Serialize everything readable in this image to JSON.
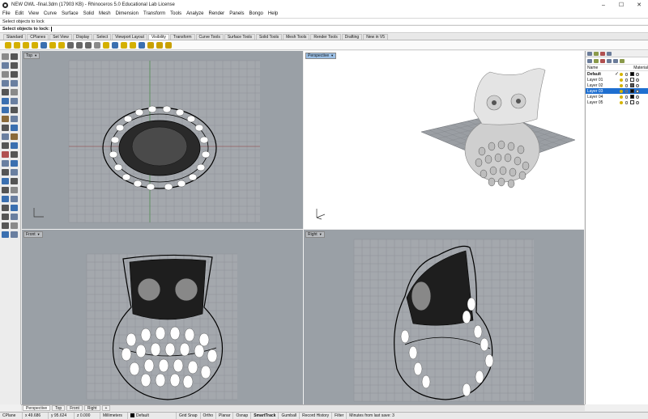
{
  "window": {
    "title": "NEW OWL -final.3dm (17903 KB) - Rhinoceros 5.0 Educational Lab License",
    "controls": [
      "–",
      "☐",
      "✕"
    ]
  },
  "menu": [
    "File",
    "Edit",
    "View",
    "Curve",
    "Surface",
    "Solid",
    "Mesh",
    "Dimension",
    "Transform",
    "Tools",
    "Analyze",
    "Render",
    "Panels",
    "Bongo",
    "Help"
  ],
  "command": {
    "history": "Select objects to lock",
    "prompt": "Select objects to lock"
  },
  "toolbar_tabs": [
    "Standard",
    "CPlanes",
    "Set View",
    "Display",
    "Select",
    "Viewport Layout",
    "Visibility",
    "Transform",
    "Curve Tools",
    "Surface Tools",
    "Solid Tools",
    "Mesh Tools",
    "Render Tools",
    "Drafting",
    "New in V5"
  ],
  "active_toolbar_tab": "Visibility",
  "toolbar_icon_colors": [
    "#d4b000",
    "#d4b000",
    "#d4b000",
    "#d4b000",
    "#3a6fb0",
    "#d4b000",
    "#d4b000",
    "#666",
    "#666",
    "#666",
    "#8a8a8a",
    "#d4b000",
    "#3a6fb0",
    "#d4b000",
    "#d4b000",
    "#3a6fb0",
    "#c8a000",
    "#c8a000",
    "#c8a000"
  ],
  "viewports": {
    "top": {
      "label": "Top"
    },
    "perspective": {
      "label": "Perspective"
    },
    "front": {
      "label": "Front"
    },
    "right": {
      "label": "Right"
    }
  },
  "layers": {
    "columns": {
      "name": "Name",
      "material": "Material"
    },
    "rows": [
      {
        "name": "Default",
        "current": true,
        "color": "#000000",
        "selected": false
      },
      {
        "name": "Layer 01",
        "current": false,
        "color": "#ffffff",
        "selected": false
      },
      {
        "name": "Layer 02",
        "current": false,
        "color": "#555555",
        "selected": false
      },
      {
        "name": "Layer 03",
        "current": false,
        "color": "#000000",
        "selected": true
      },
      {
        "name": "Layer 04",
        "current": false,
        "color": "#000000",
        "selected": false
      },
      {
        "name": "Layer 05",
        "current": false,
        "color": "#ffffff",
        "selected": false
      }
    ]
  },
  "viewport_tabs": [
    "Perspective",
    "Top",
    "Front",
    "Right",
    "+"
  ],
  "status": {
    "cplane": "CPlane",
    "x": "x 49.686",
    "y": "y 95.624",
    "z": "z 0.000",
    "units": "Millimeters",
    "layer": "Default",
    "toggles": [
      "Grid Snap",
      "Ortho",
      "Planar",
      "Osnap",
      "SmartTrack",
      "Gumball",
      "Record History",
      "Filter"
    ],
    "message": "Minutes from last save: 3"
  }
}
